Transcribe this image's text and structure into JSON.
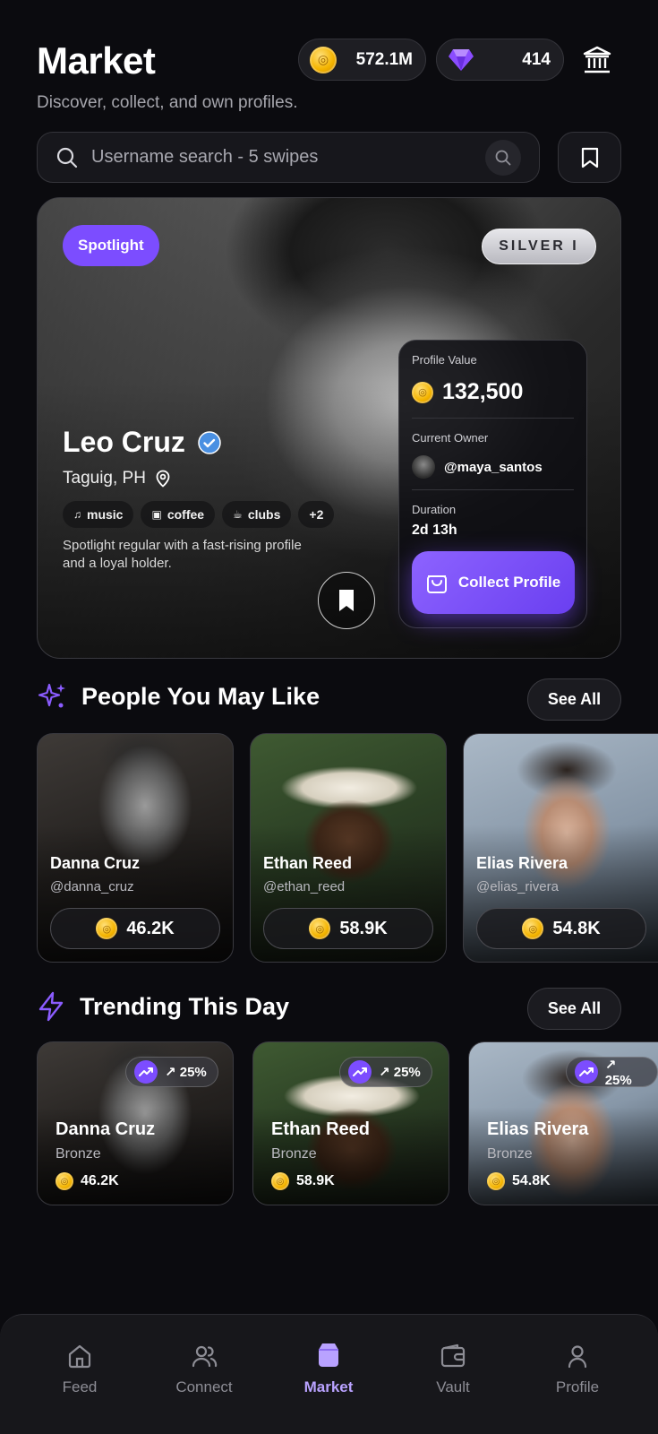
{
  "header": {
    "title": "Market",
    "subtitle": "Discover, collect, and own profiles.",
    "coins": "572.1M",
    "gems": "414"
  },
  "search": {
    "placeholder": "Username search - 5 swipes"
  },
  "spotlight": {
    "badge": "Spotlight",
    "tier": "SILVER I",
    "name": "Leo Cruz",
    "location": "Taguig, PH",
    "tags": [
      "music",
      "coffee",
      "clubs"
    ],
    "more_tags": "+2",
    "description": "Spotlight regular with a fast-rising profile and a loyal holder.",
    "value_label": "Profile Value",
    "value": "132,500",
    "owner_label": "Current Owner",
    "owner": "@maya_santos",
    "duration_label": "Duration",
    "duration": "2d 13h",
    "collect_label": "Collect Profile"
  },
  "people": {
    "title": "People You May Like",
    "see_all": "See All",
    "items": [
      {
        "name": "Danna Cruz",
        "handle": "@danna_cruz",
        "price": "46.2K"
      },
      {
        "name": "Ethan Reed",
        "handle": "@ethan_reed",
        "price": "58.9K"
      },
      {
        "name": "Elias Rivera",
        "handle": "@elias_rivera",
        "price": "54.8K"
      }
    ]
  },
  "trending": {
    "title": "Trending This Day",
    "see_all": "See All",
    "items": [
      {
        "name": "Danna Cruz",
        "tier": "Bronze",
        "price": "46.2K",
        "change": "↗ 25%"
      },
      {
        "name": "Ethan Reed",
        "tier": "Bronze",
        "price": "58.9K",
        "change": "↗ 25%"
      },
      {
        "name": "Elias Rivera",
        "tier": "Bronze",
        "price": "54.8K",
        "change": "↗ 25%"
      }
    ]
  },
  "nav": {
    "items": [
      {
        "label": "Feed",
        "icon": "home-icon"
      },
      {
        "label": "Connect",
        "icon": "users-icon"
      },
      {
        "label": "Market",
        "icon": "market-icon"
      },
      {
        "label": "Vault",
        "icon": "wallet-icon"
      },
      {
        "label": "Profile",
        "icon": "user-icon"
      }
    ],
    "active": "Market"
  },
  "colors": {
    "accent": "#7c4dff",
    "background": "#0b0b0f",
    "coin": "#f4b400"
  }
}
